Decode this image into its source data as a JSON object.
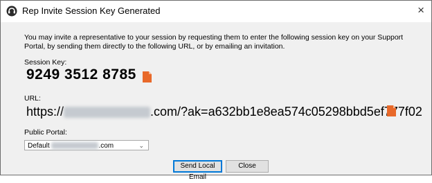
{
  "window": {
    "title": "Rep Invite Session Key Generated",
    "close_glyph": "×"
  },
  "description": "You may invite a representative to your session by requesting them to enter the following session key on your Support Portal, by sending them directly to the following URL, or by emailing an invitation.",
  "session_key": {
    "label": "Session Key:",
    "value": "9249 3512 8785",
    "copy_icon": "copy-icon"
  },
  "url": {
    "label": "URL:",
    "prefix": "https://",
    "suffix": ".com/?ak=a632bb1e8ea574c05298bbd5ef777f02",
    "copy_icon": "copy-icon"
  },
  "public_portal": {
    "label": "Public Portal:",
    "selected_prefix": "Default",
    "selected_suffix": ".com"
  },
  "buttons": {
    "send_email": "Send Local Email",
    "close": "Close"
  },
  "colors": {
    "copy_icon": "#e8692a",
    "accent_border": "#0078d7"
  }
}
